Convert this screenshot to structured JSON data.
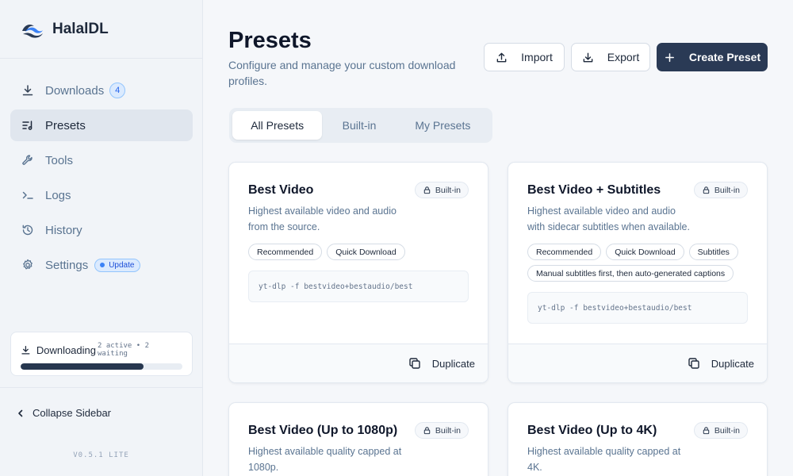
{
  "app": {
    "name": "HalalDL",
    "version": "V0.5.1 LITE"
  },
  "sidebar": {
    "items": [
      {
        "label": "Downloads",
        "icon": "download-icon",
        "badge": "4"
      },
      {
        "label": "Presets",
        "icon": "list-music-icon",
        "active": true
      },
      {
        "label": "Tools",
        "icon": "wrench-icon"
      },
      {
        "label": "Logs",
        "icon": "terminal-icon"
      },
      {
        "label": "History",
        "icon": "history-icon"
      },
      {
        "label": "Settings",
        "icon": "gear-icon",
        "badge": "Update"
      }
    ],
    "status": {
      "label": "Downloading",
      "meta": "2 active • 2 waiting",
      "progress": 0.76
    },
    "collapse_label": "Collapse Sidebar"
  },
  "header": {
    "title": "Presets",
    "subtitle": "Configure and manage your custom download profiles.",
    "import_label": "Import",
    "export_label": "Export",
    "create_label": "Create Preset"
  },
  "tabs": [
    "All Presets",
    "Built-in",
    "My Presets"
  ],
  "presets": [
    {
      "title": "Best Video",
      "badge": "Built-in",
      "desc_lines": [
        "Highest available video and audio",
        "from the source."
      ],
      "tags": [
        "Recommended",
        "Quick Download"
      ],
      "command": "yt-dlp -f bestvideo+bestaudio/best",
      "action": "Duplicate"
    },
    {
      "title": "Best Video + Subtitles",
      "badge": "Built-in",
      "desc_lines": [
        "Highest available video and audio",
        "with sidecar subtitles when available."
      ],
      "tags": [
        "Recommended",
        "Quick Download",
        "Subtitles",
        "Manual subtitles first, then auto-generated captions"
      ],
      "command": "yt-dlp -f bestvideo+bestaudio/best",
      "action": "Duplicate"
    },
    {
      "title": "Best Video (Up to 1080p)",
      "badge": "Built-in",
      "desc_lines": [
        "Highest available quality capped at",
        "1080p."
      ]
    },
    {
      "title": "Best Video (Up to 4K)",
      "badge": "Built-in",
      "desc_lines": [
        "Highest available quality capped at",
        "4K."
      ]
    }
  ],
  "colors": {
    "primary": "#2a3a55",
    "accent": "#3b82f6",
    "muted_text": "#5a7491"
  }
}
